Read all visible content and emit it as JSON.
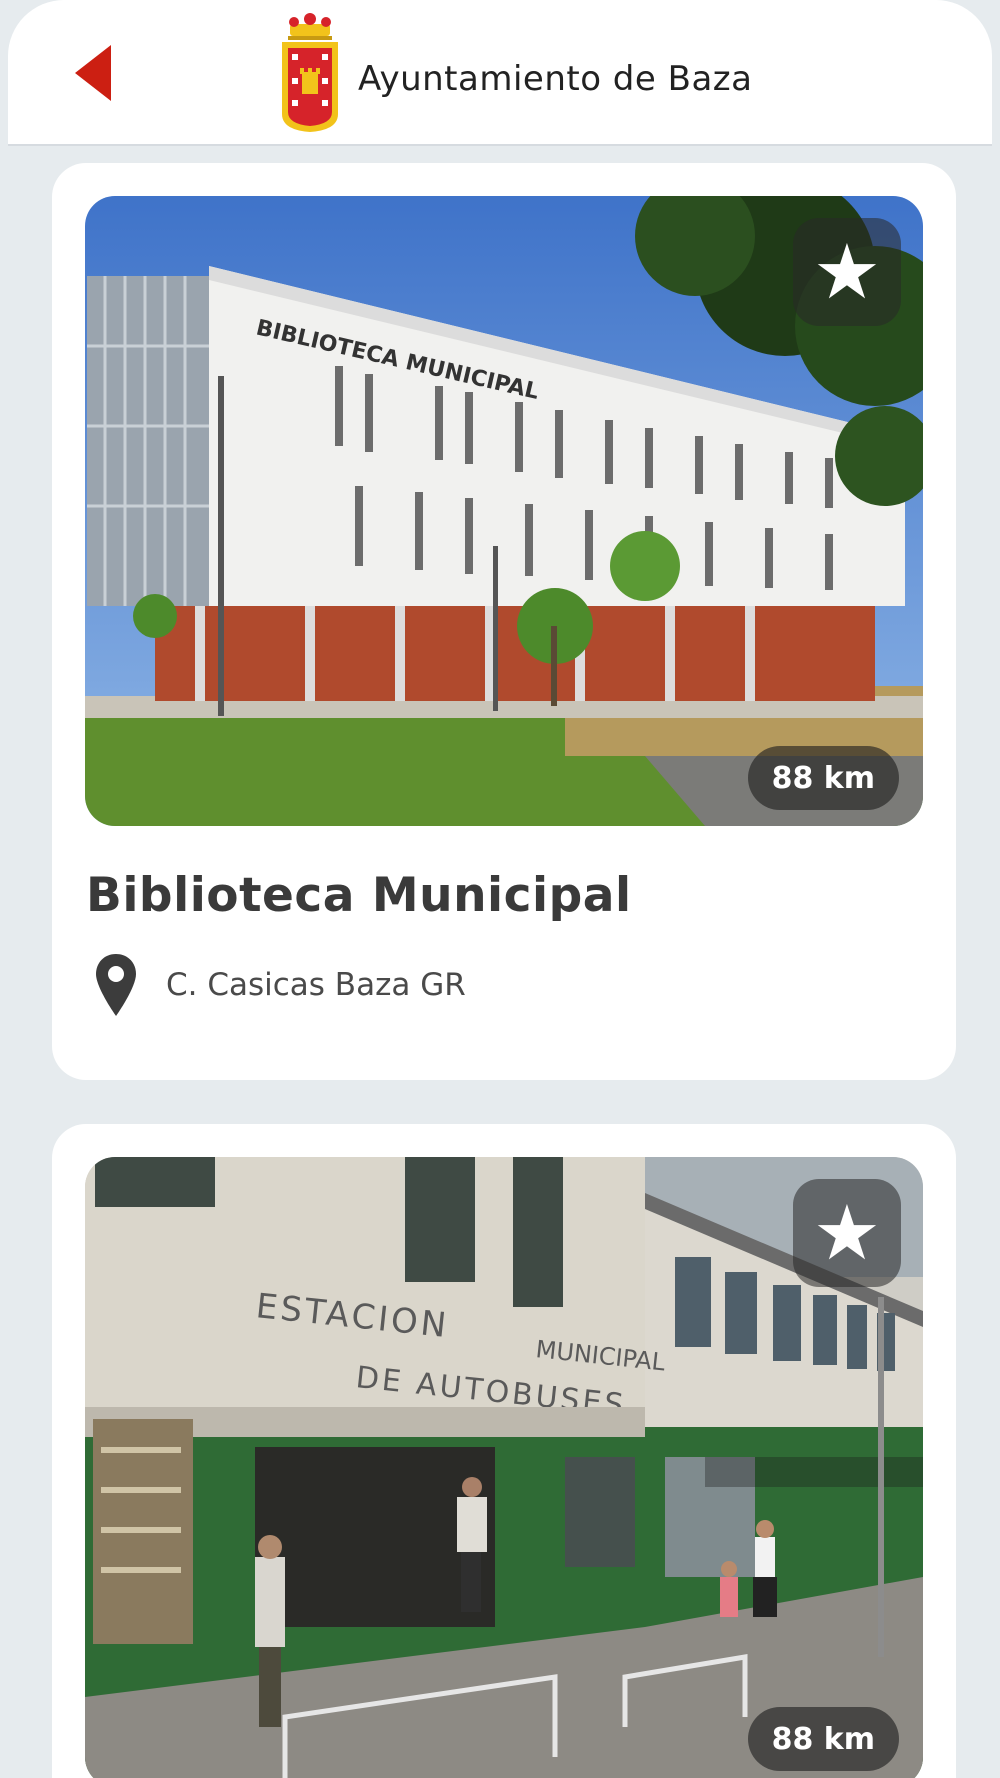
{
  "header": {
    "logo_text": "Ayuntamiento de Baza",
    "back_icon": "back-arrow-icon",
    "colors": {
      "back": "#cc1f12",
      "crest_red": "#d6232a",
      "crest_gold": "#f2c31b"
    }
  },
  "cards": [
    {
      "title": "Biblioteca Municipal",
      "address": "C. Casicas Baza GR",
      "distance": "88 km",
      "favorite_icon": "star-icon",
      "location_icon": "map-pin-icon",
      "photo_subject": "library-building-photo"
    },
    {
      "title": "",
      "address": "",
      "distance": "88 km",
      "favorite_icon": "star-icon",
      "photo_subject": "bus-station-photo"
    }
  ],
  "photo_signage": {
    "library_sign": "BIBLIOTECA MUNICIPAL",
    "bus_sign_line1": "ESTACION MUNICIPAL",
    "bus_sign_line2": "DE AUTOBUSES"
  }
}
